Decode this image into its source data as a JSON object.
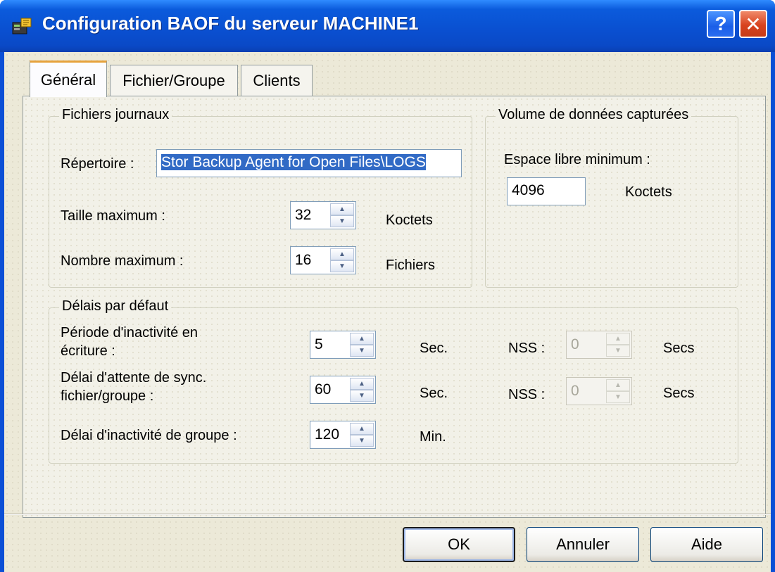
{
  "window": {
    "title": "Configuration BAOF du serveur MACHINE1",
    "help_glyph": "?",
    "close_glyph": "✕"
  },
  "tabs": [
    {
      "label": "Général",
      "active": true
    },
    {
      "label": "Fichier/Groupe",
      "active": false
    },
    {
      "label": "Clients",
      "active": false
    }
  ],
  "log_files": {
    "title": "Fichiers journaux",
    "directory_label": "Répertoire :",
    "directory_value": "Stor Backup Agent for Open Files\\LOGS",
    "max_size_label": "Taille maximum :",
    "max_size_value": "32",
    "max_size_unit": "Koctets",
    "max_count_label": "Nombre maximum :",
    "max_count_value": "16",
    "max_count_unit": "Fichiers"
  },
  "captured_volume": {
    "title": "Volume de données capturées",
    "free_space_label": "Espace libre minimum :",
    "free_space_value": "4096",
    "free_space_unit": "Koctets"
  },
  "default_delays": {
    "title": "Délais par défaut",
    "write_idle_label_1": "Période d'inactivité en",
    "write_idle_label_2": "écriture :",
    "write_idle_value": "5",
    "write_idle_unit": "Sec.",
    "write_idle_nss_label": "NSS :",
    "write_idle_nss_value": "0",
    "write_idle_nss_unit": "Secs",
    "sync_wait_label_1": "Délai d'attente de sync.",
    "sync_wait_label_2": "fichier/groupe :",
    "sync_wait_value": "60",
    "sync_wait_unit": "Sec.",
    "sync_wait_nss_label": "NSS :",
    "sync_wait_nss_value": "0",
    "sync_wait_nss_unit": "Secs",
    "group_idle_label": "Délai d'inactivité de groupe :",
    "group_idle_value": "120",
    "group_idle_unit": "Min."
  },
  "buttons": {
    "ok": "OK",
    "cancel": "Annuler",
    "help": "Aide"
  },
  "icons": {
    "app": "server-app-icon",
    "spin_up": "▲",
    "spin_down": "▼"
  },
  "colors": {
    "titlebar": "#0a4fd0",
    "selection": "#316ac5",
    "close_button": "#d8431f"
  }
}
